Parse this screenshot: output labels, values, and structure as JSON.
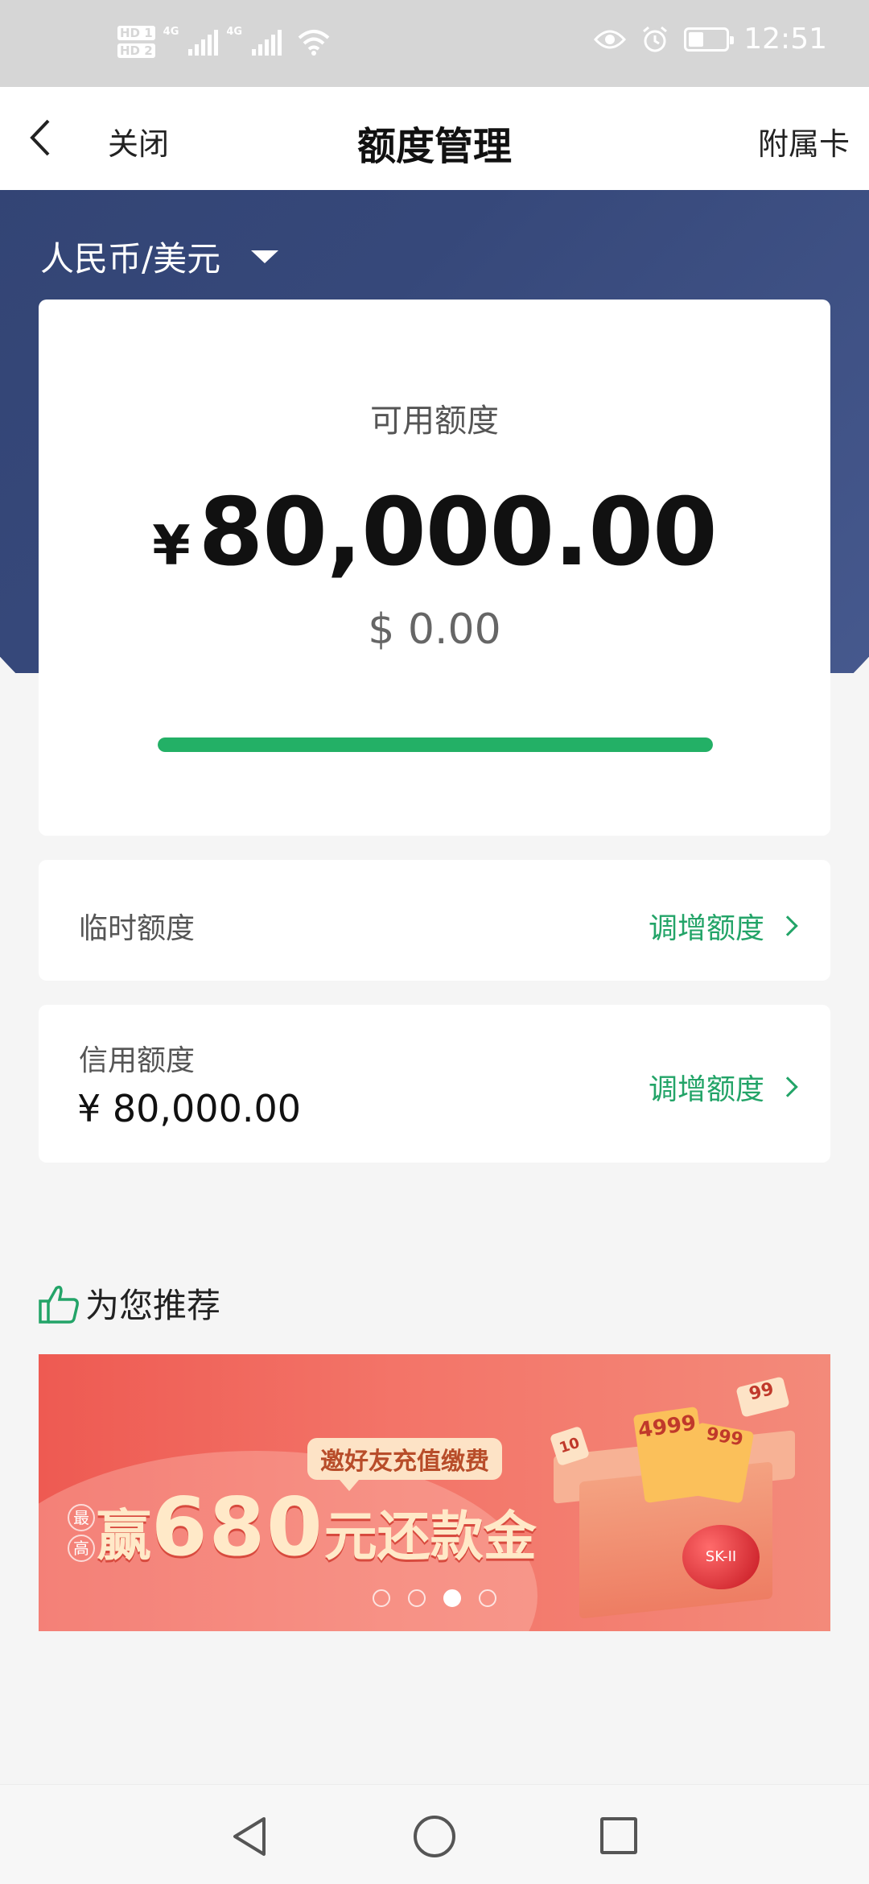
{
  "status_bar": {
    "hd1": "HD 1",
    "hd2": "HD 2",
    "net1": "4G",
    "net2": "4G",
    "time": "12:51",
    "battery_level": 0.4
  },
  "nav": {
    "close_label": "关闭",
    "title": "额度管理",
    "right_label": "附属卡"
  },
  "currency_selector": {
    "label": "人民币/美元"
  },
  "available": {
    "label": "可用额度",
    "currency_symbol": "¥",
    "amount": "80,000.00",
    "usd_amount": "$ 0.00",
    "progress_percent": 100,
    "progress_color": "#23b066"
  },
  "temporary_limit": {
    "label": "临时额度",
    "action": "调增额度"
  },
  "credit_limit": {
    "label": "信用额度",
    "value": "¥ 80,000.00",
    "action": "调增额度"
  },
  "recommend": {
    "title": "为您推荐",
    "banner": {
      "badge": "邀好友充值缴费",
      "mini_1": "最",
      "mini_2": "高",
      "word1": "赢",
      "word2": "680",
      "word3": "元还款金",
      "ticket_1": "4999",
      "ticket_2": "999",
      "ticket_3": "99",
      "ticket_4": "10",
      "jar_text": "SK-II",
      "slides": 4,
      "active_slide": 3
    }
  },
  "colors": {
    "accent_green": "#23a468",
    "header_blue": "#2e3f6d",
    "banner_red": "#ee5a52"
  }
}
